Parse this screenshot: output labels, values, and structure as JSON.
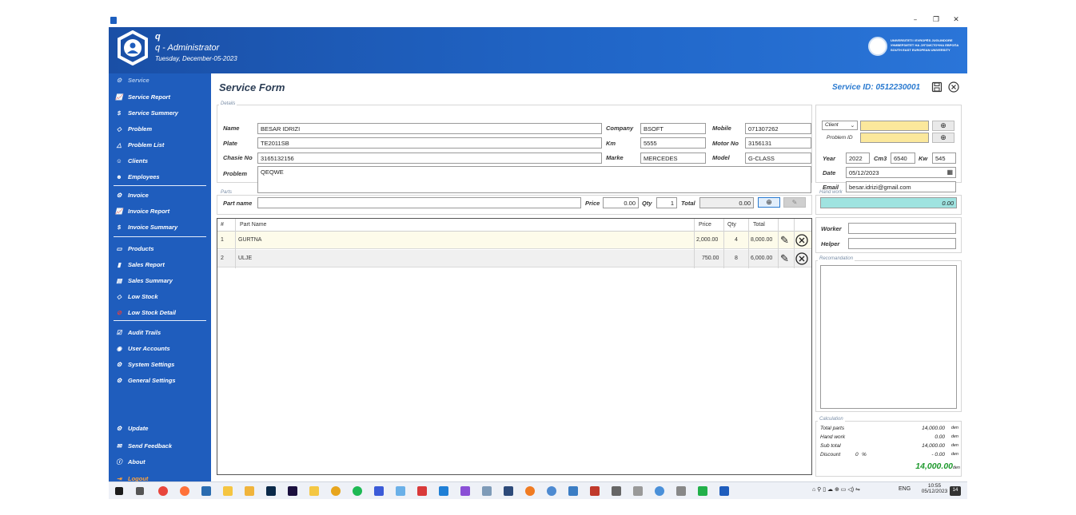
{
  "window": {
    "minimize": "–",
    "maximize": "❐",
    "close": "✕"
  },
  "header": {
    "username": "q",
    "role": "q - Administrator",
    "date": "Tuesday, December-05-2023",
    "uni_line1": "UNIVERSITETI I EVROPËS JUGLINDORE",
    "uni_line2": "УНИВЕРЗИТЕТ НА ЈУГОИСТОЧНА ЕВРОПА",
    "uni_line3": "SOUTH EAST EUROPEAN UNIVERSITY"
  },
  "sidebar": {
    "items": [
      {
        "label": "Service",
        "icon": "wrench-icon"
      },
      {
        "label": "Service Report",
        "icon": "chart-line-icon"
      },
      {
        "label": "Service Summery",
        "icon": "dollar-circle-icon"
      },
      {
        "label": "Problem",
        "icon": "diamond-icon"
      },
      {
        "label": "Problem List",
        "icon": "warning-icon"
      },
      {
        "label": "Clients",
        "icon": "user-icon"
      },
      {
        "label": "Employees",
        "icon": "users-icon"
      },
      {
        "label": "Invoice",
        "icon": "wrench-icon"
      },
      {
        "label": "Invoice Report",
        "icon": "chart-line-icon"
      },
      {
        "label": "Invoice Summary",
        "icon": "dollar-circle-icon"
      },
      {
        "label": "Products",
        "icon": "box-icon"
      },
      {
        "label": "Sales Report",
        "icon": "bar-chart-icon"
      },
      {
        "label": "Sales Summary",
        "icon": "receipt-icon"
      },
      {
        "label": "Low Stock",
        "icon": "diamond-icon"
      },
      {
        "label": "Low Stock Detail",
        "icon": "alert-circle-icon"
      },
      {
        "label": "Audit Trails",
        "icon": "checkbox-icon"
      },
      {
        "label": "User Accounts",
        "icon": "user-circle-icon"
      },
      {
        "label": "System Settings",
        "icon": "gear-icon"
      },
      {
        "label": "General Settings",
        "icon": "gear-icon"
      },
      {
        "label": "Update",
        "icon": "update-gear-icon"
      },
      {
        "label": "Send Feedback",
        "icon": "mail-icon"
      },
      {
        "label": "About",
        "icon": "info-icon"
      },
      {
        "label": "Logout",
        "icon": "logout-icon"
      }
    ]
  },
  "form": {
    "title": "Service Form",
    "service_id": "Service ID: 0512230001",
    "details_group": "Details",
    "name_label": "Name",
    "name": "BESAR IDRIZI",
    "plate_label": "Plate",
    "plate": "TE2011SB",
    "chasis_label": "Chasie No",
    "chasis": "3165132156",
    "problem_label": "Problem",
    "problem": "QEQWE",
    "company_label": "Company",
    "company": "BSOFT",
    "km_label": "Km",
    "km": "5555",
    "marke_label": "Marke",
    "marke": "MERCEDES",
    "mobile_label": "Mobile",
    "mobile": "071307262",
    "motor_label": "Motor No",
    "motor": "3156131",
    "model_label": "Model",
    "model": "G-CLASS",
    "client_select": "Client",
    "problem_id_label": "Problem ID",
    "year_label": "Year",
    "year": "2022",
    "cm3_label": "Cm3",
    "cm3": "6540",
    "kw_label": "Kw",
    "kw": "545",
    "date_label": "Date",
    "date": "05/12/2023",
    "email_label": "Email",
    "email": "besar.idrizi@gmail.com"
  },
  "parts": {
    "group": "Parts",
    "part_name_label": "Part name",
    "part_name": "",
    "price_label": "Price",
    "price": "0.00",
    "qty_label": "Qty",
    "qty": "1",
    "total_label": "Total",
    "total": "0.00"
  },
  "table": {
    "columns": [
      "#",
      "Part Name",
      "Price",
      "Qty",
      "Total"
    ],
    "rows": [
      {
        "no": "1",
        "name": "GURTNA",
        "price": "2,000.00",
        "qty": "4",
        "total": "8,000.00"
      },
      {
        "no": "2",
        "name": "ULJE",
        "price": "750.00",
        "qty": "8",
        "total": "6,000.00"
      }
    ]
  },
  "hand_work": {
    "group": "Hand work",
    "value": "0.00"
  },
  "staff": {
    "worker_label": "Worker",
    "worker": "",
    "helper_label": "Helper",
    "helper": ""
  },
  "recommendation": {
    "group": "Recomandation",
    "text": ""
  },
  "calculation": {
    "group": "Calculation",
    "total_parts_label": "Total parts",
    "total_parts": "14,000.00",
    "hand_work_label": "Hand work",
    "hand_work": "0.00",
    "sub_total_label": "Sub total",
    "sub_total": "14,000.00",
    "discount_label": "Discount",
    "discount_pct": "0",
    "pct_sign": "%",
    "discount": "- 0.00",
    "grand_total": "14,000.00",
    "currency": "den"
  },
  "taskbar": {
    "lang": "ENG",
    "time": "10:55",
    "date": "05/12/2023",
    "notif": "14"
  },
  "colors": {
    "accent": "#1f5dbd",
    "header": "#2167c9",
    "highlight": "#fbe89c",
    "total_green": "#1f9a2e"
  }
}
